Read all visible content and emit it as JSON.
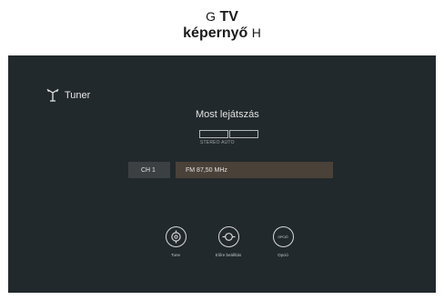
{
  "header": {
    "line1_prefix": "G",
    "line1_bold": "TV",
    "line2_bold": "képernyő",
    "line2_suffix": "H"
  },
  "tuner": {
    "label": "Tuner"
  },
  "now_playing": {
    "title": "Most lejátszás",
    "mode": "STEREO AUTO"
  },
  "station": {
    "channel": "CH 1",
    "frequency": "FM 87,50 MHz"
  },
  "buttons": [
    {
      "label": "Tune",
      "icon": "tune-icon"
    },
    {
      "label": "Előre beállítás",
      "icon": "preset-icon"
    },
    {
      "label": "Opció",
      "icon": "option-icon",
      "icon_text": "OPCIÓ"
    }
  ]
}
